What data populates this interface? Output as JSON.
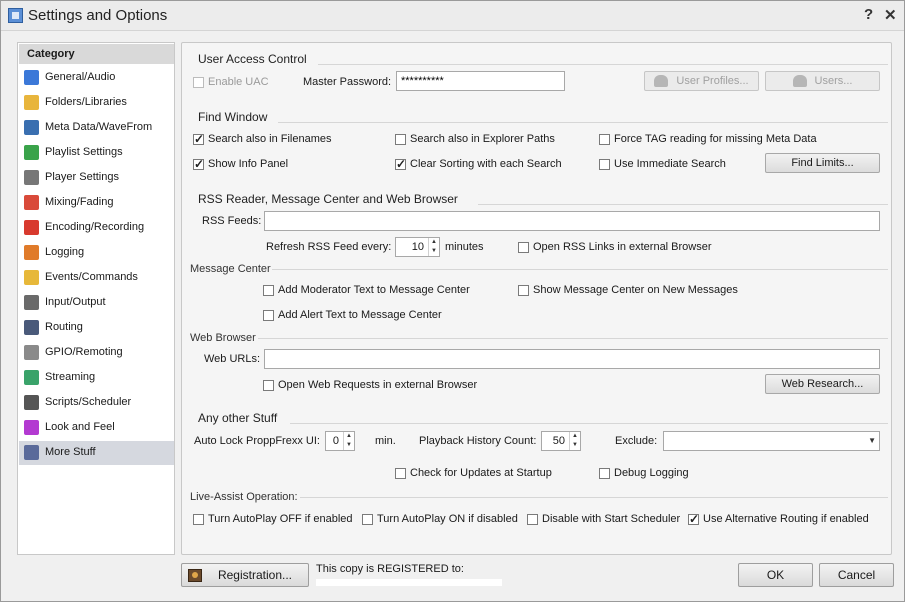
{
  "window": {
    "title": "Settings and Options",
    "help_glyph": "?",
    "close_glyph": "✕"
  },
  "sidebar": {
    "header": "Category",
    "items": [
      {
        "label": "General/Audio",
        "icon": "music-note-icon",
        "color": "#3b78d8"
      },
      {
        "label": "Folders/Libraries",
        "icon": "folder-icon",
        "color": "#e8b53c"
      },
      {
        "label": "Meta Data/WaveFrom",
        "icon": "waveform-icon",
        "color": "#3a6fb0"
      },
      {
        "label": "Playlist Settings",
        "icon": "playlist-icon",
        "color": "#3aa34a"
      },
      {
        "label": "Player Settings",
        "icon": "player-icon",
        "color": "#777777"
      },
      {
        "label": "Mixing/Fading",
        "icon": "mixing-icon",
        "color": "#d94a3a"
      },
      {
        "label": "Encoding/Recording",
        "icon": "record-icon",
        "color": "#d83a2e"
      },
      {
        "label": "Logging",
        "icon": "logging-icon",
        "color": "#e07b2a"
      },
      {
        "label": "Events/Commands",
        "icon": "lightning-icon",
        "color": "#e7b83a"
      },
      {
        "label": "Input/Output",
        "icon": "input-output-icon",
        "color": "#6a6a6a"
      },
      {
        "label": "Routing",
        "icon": "routing-icon",
        "color": "#4a5a7a"
      },
      {
        "label": "GPIO/Remoting",
        "icon": "gpio-icon",
        "color": "#8a8a8a"
      },
      {
        "label": "Streaming",
        "icon": "streaming-icon",
        "color": "#3aa36a"
      },
      {
        "label": "Scripts/Scheduler",
        "icon": "clock-icon",
        "color": "#555555"
      },
      {
        "label": "Look and Feel",
        "icon": "palette-icon",
        "color": "#b33ad1"
      },
      {
        "label": "More Stuff",
        "icon": "tools-icon",
        "color": "#5a6a9a"
      }
    ],
    "selected": "More Stuff"
  },
  "uac": {
    "title": "User Access Control",
    "enable_uac": "Enable UAC",
    "master_password_label": "Master Password:",
    "master_password_value": "**********",
    "user_profiles_btn": "User Profiles...",
    "users_btn": "Users..."
  },
  "find": {
    "title": "Find Window",
    "search_filenames": "Search also in Filenames",
    "search_explorer": "Search also in Explorer Paths",
    "force_tag": "Force TAG reading for missing Meta Data",
    "show_info": "Show Info Panel",
    "clear_sorting": "Clear Sorting with each Search",
    "immediate_search": "Use Immediate Search",
    "find_limits_btn": "Find Limits..."
  },
  "rss": {
    "title": "RSS Reader, Message Center and Web Browser",
    "feeds_label": "RSS Feeds:",
    "feeds_value": "",
    "refresh_label": "Refresh RSS Feed every:",
    "refresh_value": "10",
    "refresh_unit": "minutes",
    "open_external": "Open RSS Links in external Browser",
    "message_center_title": "Message Center",
    "add_moderator": "Add Moderator Text to Message Center",
    "show_on_new": "Show Message Center on New Messages",
    "add_alert": "Add Alert Text to Message Center",
    "web_browser_title": "Web Browser",
    "web_urls_label": "Web URLs:",
    "web_urls_value": "",
    "open_web_external": "Open Web Requests in external Browser",
    "web_research_btn": "Web Research..."
  },
  "other": {
    "title": "Any other Stuff",
    "auto_lock_label": "Auto Lock ProppFrexx UI:",
    "auto_lock_value": "0",
    "auto_lock_unit": "min.",
    "history_label": "Playback History Count:",
    "history_value": "50",
    "exclude_label": "Exclude:",
    "exclude_value": "",
    "check_updates": "Check for Updates at Startup",
    "debug_logging": "Debug Logging",
    "live_assist_title": "Live-Assist Operation:",
    "autoplay_off": "Turn AutoPlay OFF if enabled",
    "autoplay_on": "Turn AutoPlay ON if disabled",
    "disable_scheduler": "Disable with Start Scheduler",
    "alt_routing": "Use Alternative Routing if enabled"
  },
  "footer": {
    "registration_btn": "Registration...",
    "registered_text": "This copy is REGISTERED to:",
    "ok_btn": "OK",
    "cancel_btn": "Cancel"
  }
}
